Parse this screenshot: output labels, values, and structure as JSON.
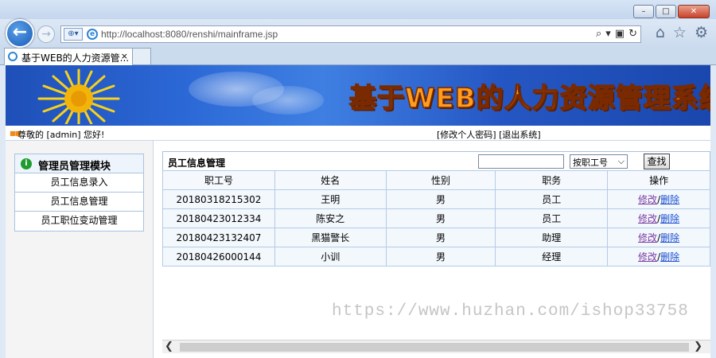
{
  "browser": {
    "address_url": "http://localhost:8080/renshi/mainframe.jsp",
    "tab_title": "基于WEB的人力资源管...",
    "tab_close": "×",
    "back_glyph": "←",
    "forward_glyph": "→",
    "minimize_glyph": "–",
    "restore_glyph": "□",
    "close_glyph": "✕",
    "icons": [
      "home-icon",
      "star-icon",
      "gear-icon"
    ]
  },
  "banner": {
    "title": "基于WEB的人力资源管理系统"
  },
  "welcome": {
    "greeting": "尊敬的 [admin] 您好!",
    "change_password": "[修改个人密码]",
    "logout": "[退出系统]"
  },
  "sidebar": {
    "title": "管理员管理模块",
    "items": [
      {
        "label": "员工信息录入"
      },
      {
        "label": "员工信息管理"
      },
      {
        "label": "员工职位变动管理"
      }
    ]
  },
  "main": {
    "title": "员工信息管理",
    "search_value": "",
    "search_type": "按职工号",
    "search_button": "查找",
    "columns": [
      "职工号",
      "姓名",
      "性别",
      "职务",
      "操作"
    ],
    "rows": [
      {
        "id": "20180318215302",
        "name": "王明",
        "gender": "男",
        "position": "员工"
      },
      {
        "id": "20180423012334",
        "name": "陈安之",
        "gender": "男",
        "position": "员工"
      },
      {
        "id": "20180423132407",
        "name": "黑猫警长",
        "gender": "男",
        "position": "助理"
      },
      {
        "id": "20180426000144",
        "name": "小训",
        "gender": "男",
        "position": "经理"
      }
    ],
    "edit_label": "修改",
    "separator": "/",
    "delete_label": "删除"
  },
  "watermark": "https://www.huzhan.com/ishop33758"
}
